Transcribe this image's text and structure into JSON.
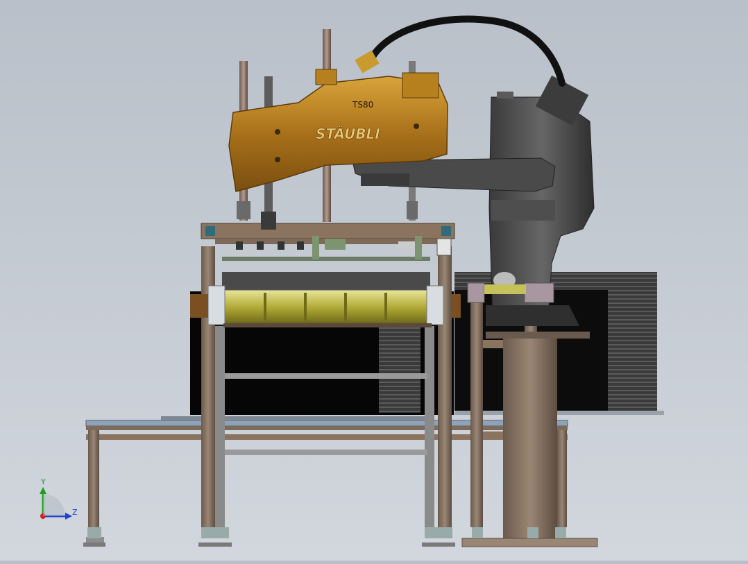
{
  "app": {
    "view_name": "3D CAD model viewport"
  },
  "robot": {
    "brand_text": "STÄUBLI",
    "model_text": "TS80",
    "arm_color": "#b7801f",
    "base_color": "#4a4a4a"
  },
  "triad": {
    "x_label": "",
    "y_label": "Y",
    "z_label": "Z"
  },
  "colors": {
    "frame_profile": "#8a7460",
    "roller": "#c9c45a",
    "conveyor_belt": "#8fa3b8",
    "background_top": "#b9c0c9",
    "background_bottom": "#d2d7de"
  },
  "icons": [
    "coordinate-triad-icon"
  ]
}
